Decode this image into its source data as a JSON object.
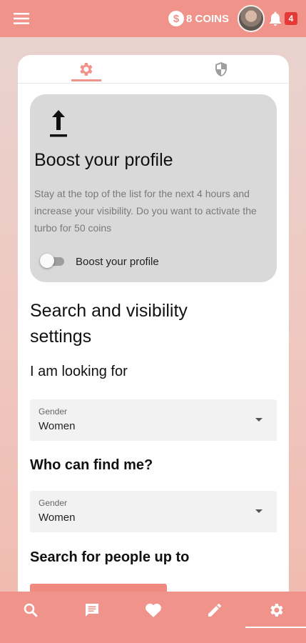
{
  "topbar": {
    "coins_label": "8 COINS",
    "coin_symbol": "$",
    "notification_count": "4",
    "accent_color": "#f0938a"
  },
  "tabs": [
    {
      "icon": "gear-icon",
      "active": true
    },
    {
      "icon": "shield-icon",
      "active": false
    }
  ],
  "boost": {
    "title": "Boost your profile",
    "description": "Stay at the top of the list for the next 4 hours and increase your visibility. Do you want to activate the turbo for 50 coins",
    "toggle_label": "Boost your profile",
    "toggle_on": false
  },
  "settings": {
    "section_title": "Search and visibility settings",
    "looking_for_heading": "I am looking for",
    "looking_for": {
      "label": "Gender",
      "value": "Women"
    },
    "who_can_find_heading": "Who can find me?",
    "who_can_find": {
      "label": "Gender",
      "value": "Women"
    },
    "search_up_to_heading": "Search for people up to"
  },
  "bottom_nav": [
    {
      "icon": "search-icon",
      "active": false
    },
    {
      "icon": "chat-icon",
      "active": false
    },
    {
      "icon": "heart-icon",
      "active": false
    },
    {
      "icon": "pencil-icon",
      "active": false
    },
    {
      "icon": "gear-icon",
      "active": true
    }
  ]
}
